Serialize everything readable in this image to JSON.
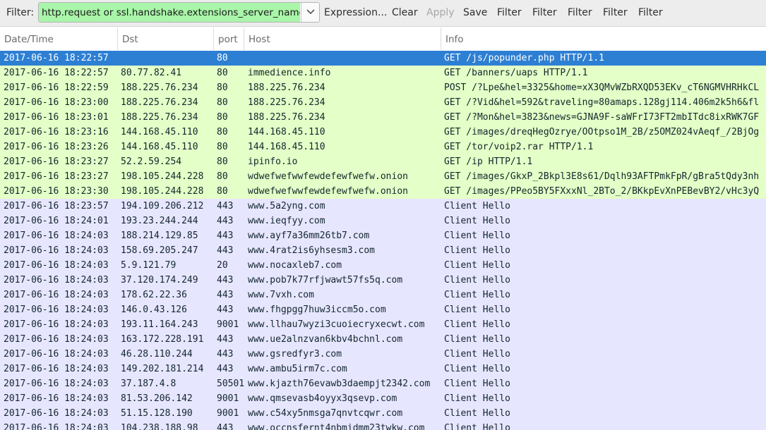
{
  "toolbar": {
    "filter_label": "Filter:",
    "filter_value": "http.request or ssl.handshake.extensions_server_name",
    "filter_color": "#a9f5a9",
    "dropdown_icon": "chevron-down-icon",
    "buttons": [
      "Expression...",
      "Clear",
      "Apply",
      "Save",
      "Filter",
      "Filter",
      "Filter",
      "Filter",
      "Filter"
    ],
    "disabled_buttons": [
      "Apply"
    ]
  },
  "columns": [
    "Date/Time",
    "Dst",
    "port",
    "Host",
    "Info"
  ],
  "colors": {
    "http_row": "#e4ffc7",
    "tls_row": "#e7e6ff",
    "selected_row": "#2d7fd3"
  },
  "packets": [
    {
      "time": "2017-06-16 18:22:57",
      "dst": "",
      "port": "80",
      "host": "",
      "info": "GET /js/popunder.php HTTP/1.1",
      "kind": "http",
      "selected": true
    },
    {
      "time": "2017-06-16 18:22:57",
      "dst": "80.77.82.41",
      "port": "80",
      "host": "immedience.info",
      "info": "GET /banners/uaps HTTP/1.1",
      "kind": "http"
    },
    {
      "time": "2017-06-16 18:22:59",
      "dst": "188.225.76.234",
      "port": "80",
      "host": "188.225.76.234",
      "info": "POST /?Lpe&hel=3325&home=xX3QMvWZbRXQD53EKv_cT6NGMVHRHkCL",
      "kind": "http"
    },
    {
      "time": "2017-06-16 18:23:00",
      "dst": "188.225.76.234",
      "port": "80",
      "host": "188.225.76.234",
      "info": "GET /?Vid&hel=592&traveling=80amaps.128gj114.406m2k5h6&fl",
      "kind": "http"
    },
    {
      "time": "2017-06-16 18:23:01",
      "dst": "188.225.76.234",
      "port": "80",
      "host": "188.225.76.234",
      "info": "GET /?Mon&hel=3823&news=GJNA9F-saWFrI73FT2mbITdc8ixRWK7GF",
      "kind": "http"
    },
    {
      "time": "2017-06-16 18:23:16",
      "dst": "144.168.45.110",
      "port": "80",
      "host": "144.168.45.110",
      "info": "GET /images/dreqHegOzrye/OOtpso1M_2B/z5OMZ024vAeqf_/2BjOg",
      "kind": "http"
    },
    {
      "time": "2017-06-16 18:23:26",
      "dst": "144.168.45.110",
      "port": "80",
      "host": "144.168.45.110",
      "info": "GET /tor/voip2.rar HTTP/1.1",
      "kind": "http"
    },
    {
      "time": "2017-06-16 18:23:27",
      "dst": "52.2.59.254",
      "port": "80",
      "host": "ipinfo.io",
      "info": "GET /ip HTTP/1.1",
      "kind": "http"
    },
    {
      "time": "2017-06-16 18:23:27",
      "dst": "198.105.244.228",
      "port": "80",
      "host": "wdwefwefwwfewdefewfwefw.onion",
      "info": "GET /images/GkxP_2Bkpl3E8s61/Dqlh93AFTPmkFpR/gBra5tQdy3nh",
      "kind": "http"
    },
    {
      "time": "2017-06-16 18:23:30",
      "dst": "198.105.244.228",
      "port": "80",
      "host": "wdwefwefwwfewdefewfwefw.onion",
      "info": "GET /images/PPeo5BY5FXxxNl_2BTo_2/BKkpEvXnPEBevBY2/vHc3yQ",
      "kind": "http"
    },
    {
      "time": "2017-06-16 18:23:57",
      "dst": "194.109.206.212",
      "port": "443",
      "host": "www.5a2yng.com",
      "info": "Client Hello",
      "kind": "tls"
    },
    {
      "time": "2017-06-16 18:24:01",
      "dst": "193.23.244.244",
      "port": "443",
      "host": "www.ieqfyy.com",
      "info": "Client Hello",
      "kind": "tls"
    },
    {
      "time": "2017-06-16 18:24:03",
      "dst": "188.214.129.85",
      "port": "443",
      "host": "www.ayf7a36mm26tb7.com",
      "info": "Client Hello",
      "kind": "tls"
    },
    {
      "time": "2017-06-16 18:24:03",
      "dst": "158.69.205.247",
      "port": "443",
      "host": "www.4rat2is6yhsesm3.com",
      "info": "Client Hello",
      "kind": "tls"
    },
    {
      "time": "2017-06-16 18:24:03",
      "dst": "5.9.121.79",
      "port": "20",
      "host": "www.nocaxleb7.com",
      "info": "Client Hello",
      "kind": "tls"
    },
    {
      "time": "2017-06-16 18:24:03",
      "dst": "37.120.174.249",
      "port": "443",
      "host": "www.pob7k77rfjwawt57fs5q.com",
      "info": "Client Hello",
      "kind": "tls"
    },
    {
      "time": "2017-06-16 18:24:03",
      "dst": "178.62.22.36",
      "port": "443",
      "host": "www.7vxh.com",
      "info": "Client Hello",
      "kind": "tls"
    },
    {
      "time": "2017-06-16 18:24:03",
      "dst": "146.0.43.126",
      "port": "443",
      "host": "www.fhgpgg7huw3iccm5o.com",
      "info": "Client Hello",
      "kind": "tls"
    },
    {
      "time": "2017-06-16 18:24:03",
      "dst": "193.11.164.243",
      "port": "9001",
      "host": "www.llhau7wyzi3cuoiecryxecwt.com",
      "info": "Client Hello",
      "kind": "tls"
    },
    {
      "time": "2017-06-16 18:24:03",
      "dst": "163.172.228.191",
      "port": "443",
      "host": "www.ue2alnzvan6kbv4bchnl.com",
      "info": "Client Hello",
      "kind": "tls"
    },
    {
      "time": "2017-06-16 18:24:03",
      "dst": "46.28.110.244",
      "port": "443",
      "host": "www.gsredfyr3.com",
      "info": "Client Hello",
      "kind": "tls"
    },
    {
      "time": "2017-06-16 18:24:03",
      "dst": "149.202.181.214",
      "port": "443",
      "host": "www.ambu5irm7c.com",
      "info": "Client Hello",
      "kind": "tls"
    },
    {
      "time": "2017-06-16 18:24:03",
      "dst": "37.187.4.8",
      "port": "50501",
      "host": "www.kjazth76evawb3daempjt2342.com",
      "info": "Client Hello",
      "kind": "tls"
    },
    {
      "time": "2017-06-16 18:24:03",
      "dst": "81.53.206.142",
      "port": "9001",
      "host": "www.qmsevasb4oyyx3qsevp.com",
      "info": "Client Hello",
      "kind": "tls"
    },
    {
      "time": "2017-06-16 18:24:03",
      "dst": "51.15.128.190",
      "port": "9001",
      "host": "www.c54xy5nmsga7qnvtcqwr.com",
      "info": "Client Hello",
      "kind": "tls"
    },
    {
      "time": "2017-06-16 18:24:03",
      "dst": "104.238.188.98",
      "port": "443",
      "host": "www.occnsfernt4nbmidmm23twkw.com",
      "info": "Client Hello",
      "kind": "tls"
    }
  ]
}
